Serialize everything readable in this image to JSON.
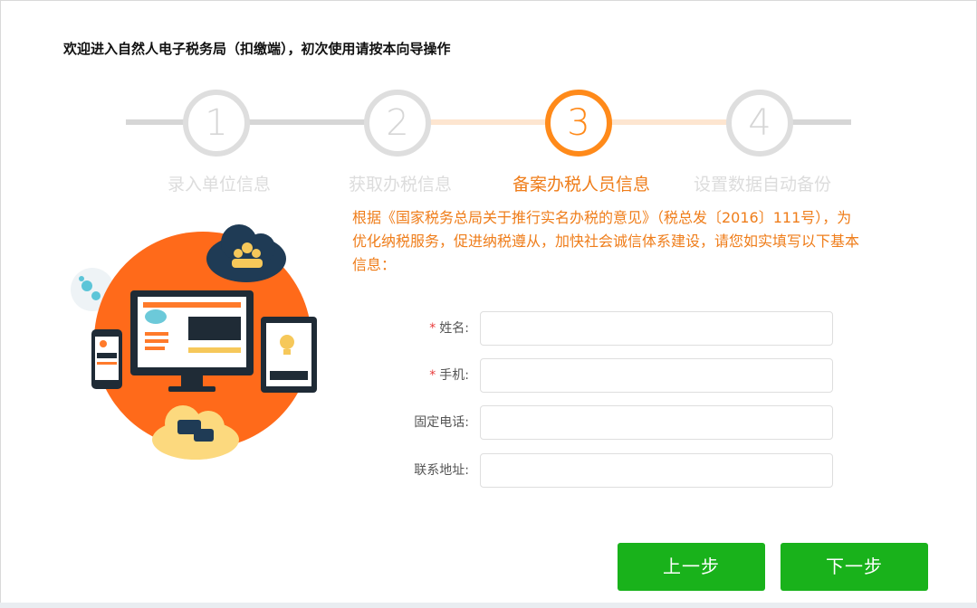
{
  "header": {
    "title": "欢迎进入自然人电子税务局（扣缴端），初次使用请按本向导操作"
  },
  "steps": [
    {
      "number": "1",
      "label": "录入单位信息",
      "state": "inactive"
    },
    {
      "number": "2",
      "label": "获取办税信息",
      "state": "inactive"
    },
    {
      "number": "3",
      "label": "备案办税人员信息",
      "state": "active"
    },
    {
      "number": "4",
      "label": "设置数据自动备份",
      "state": "inactive"
    }
  ],
  "intro": {
    "text": "根据《国家税务总局关于推行实名办税的意见》（税总发〔2016〕111号），为优化纳税服务，促进纳税遵从，加快社会诚信体系建设，请您如实填写以下基本信息："
  },
  "form": {
    "fields": [
      {
        "label": "姓名:",
        "required": true,
        "value": ""
      },
      {
        "label": "手机:",
        "required": true,
        "value": ""
      },
      {
        "label": "固定电话:",
        "required": false,
        "value": ""
      },
      {
        "label": "联系地址:",
        "required": false,
        "value": ""
      }
    ],
    "required_mark": "*"
  },
  "buttons": {
    "prev_label": "上一步",
    "next_label": "下一步"
  },
  "colors": {
    "accent": "#ff8a1a",
    "inactive": "#dedede",
    "button": "#19b21b",
    "required": "#e83a3a"
  }
}
